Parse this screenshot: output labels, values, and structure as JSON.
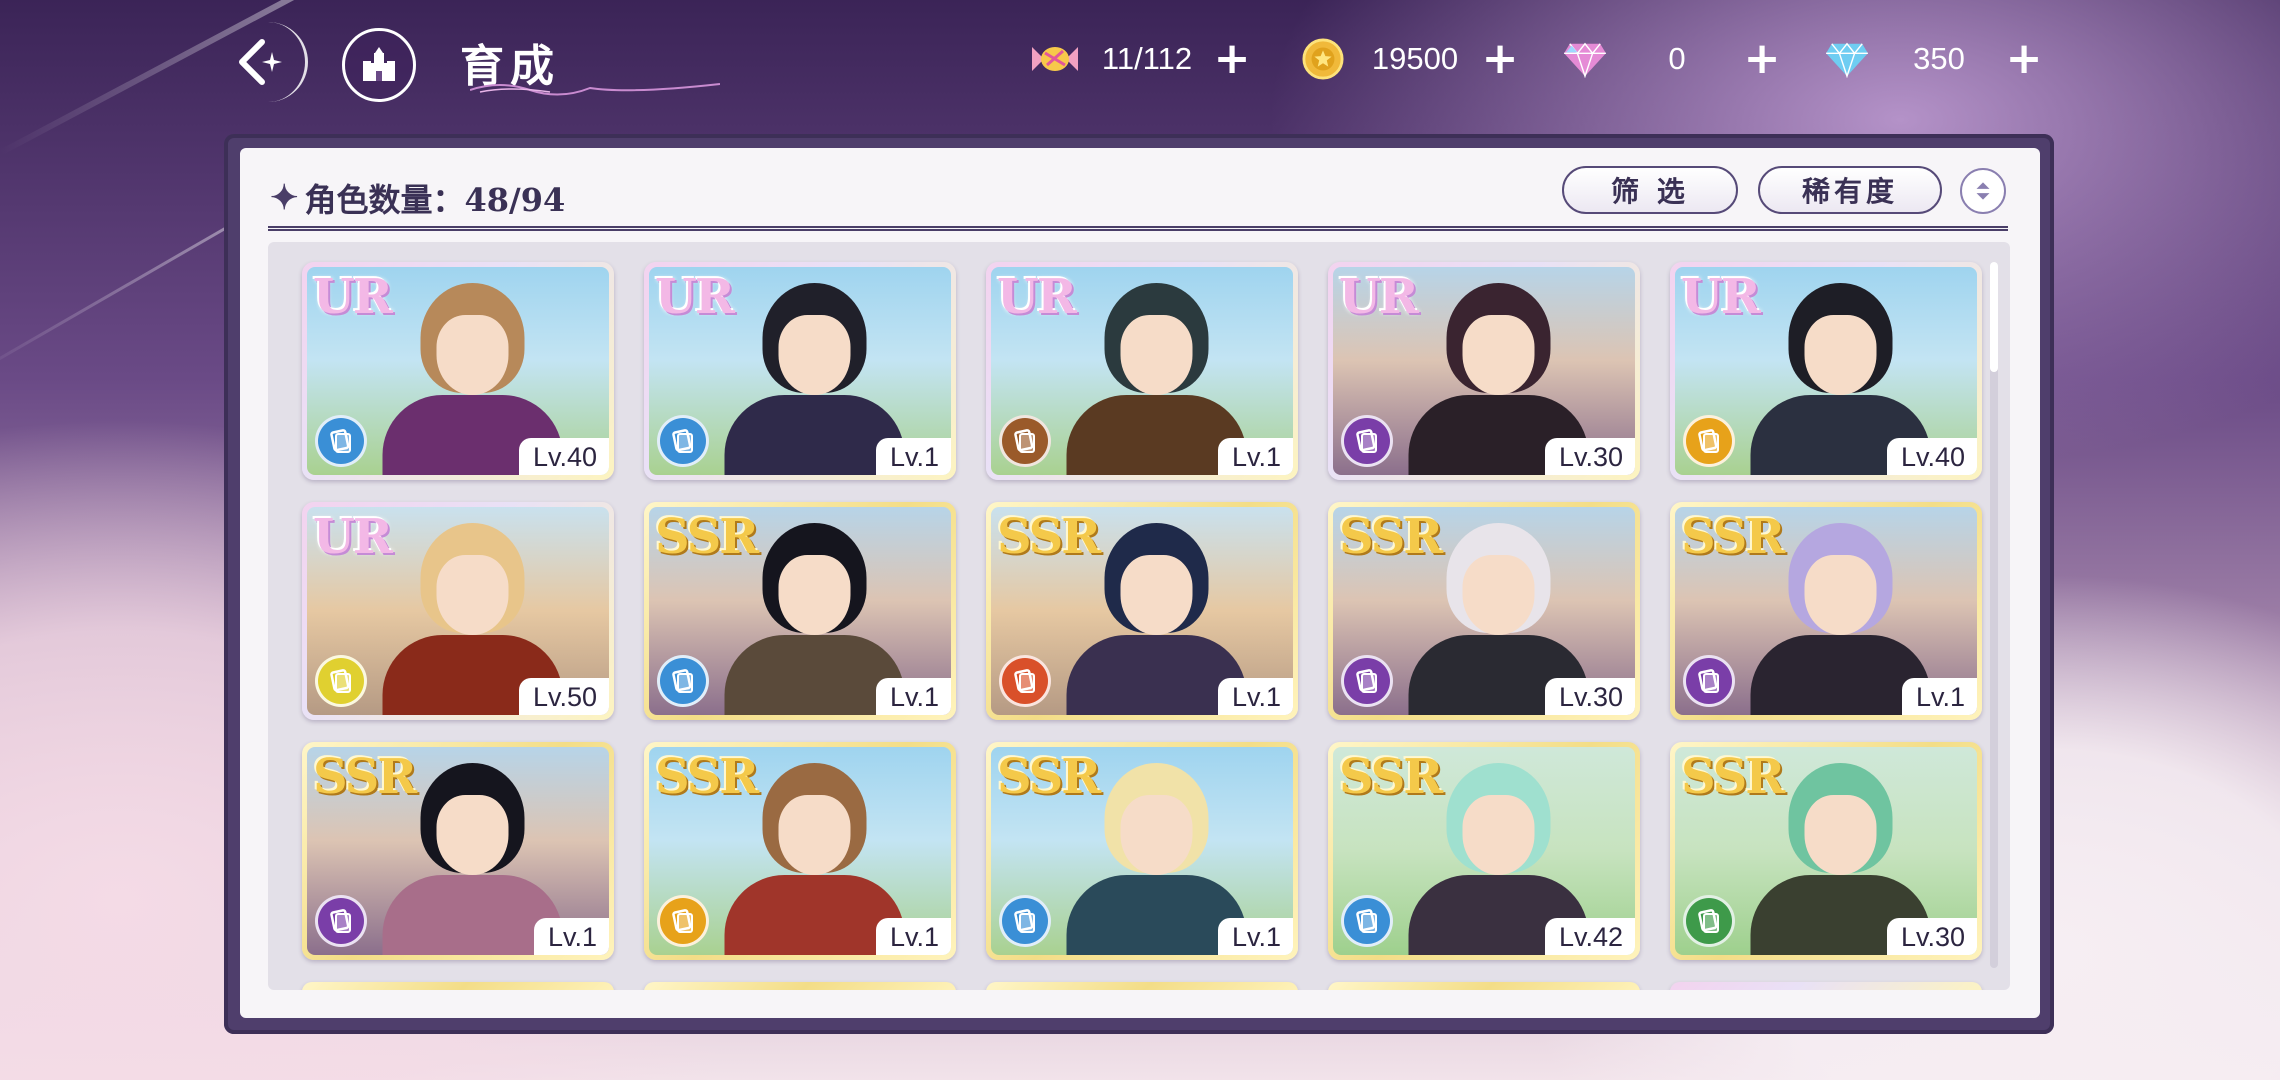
{
  "header": {
    "title": "育成",
    "resources": [
      {
        "name": "candy",
        "value": "11/112"
      },
      {
        "name": "gold-coin",
        "value": "19500"
      },
      {
        "name": "pink-gem",
        "value": "0"
      },
      {
        "name": "blue-gem",
        "value": "350"
      }
    ]
  },
  "panel": {
    "count_label": "角色数量：48/94",
    "filter_label": "筛 选",
    "sort_label": "稀有度"
  },
  "cards": [
    {
      "rarity": "UR",
      "level": "Lv.40",
      "type_color": "#3a8fd6",
      "hair": "#b7895a",
      "body": "#6b2f6e",
      "bg": "sky"
    },
    {
      "rarity": "UR",
      "level": "Lv.1",
      "type_color": "#3a8fd6",
      "hair": "#20202a",
      "body": "#2f2a4a",
      "bg": "sky"
    },
    {
      "rarity": "UR",
      "level": "Lv.1",
      "type_color": "#9a5a2a",
      "hair": "#2b3a3e",
      "body": "#5a3a22",
      "bg": "sky"
    },
    {
      "rarity": "UR",
      "level": "Lv.30",
      "type_color": "#7a3ea8",
      "hair": "#3a2430",
      "body": "#2a2028",
      "bg": "city"
    },
    {
      "rarity": "UR",
      "level": "Lv.40",
      "type_color": "#e7a21a",
      "hair": "#1e1e26",
      "body": "#2b3040",
      "bg": "sky"
    },
    {
      "rarity": "UR",
      "level": "Lv.50",
      "type_color": "#e0d030",
      "hair": "#e8c58a",
      "body": "#8a2a1a",
      "bg": "warm"
    },
    {
      "rarity": "SSR",
      "level": "Lv.1",
      "type_color": "#3a8fd6",
      "hair": "#15151e",
      "body": "#5a4a3a",
      "bg": "city"
    },
    {
      "rarity": "SSR",
      "level": "Lv.1",
      "type_color": "#d9502a",
      "hair": "#1f2a4a",
      "body": "#3a3050",
      "bg": "warm"
    },
    {
      "rarity": "SSR",
      "level": "Lv.30",
      "type_color": "#7a3ea8",
      "hair": "#e8e4ea",
      "body": "#2a2a32",
      "bg": "city"
    },
    {
      "rarity": "SSR",
      "level": "Lv.1",
      "type_color": "#7a3ea8",
      "hair": "#b5a7e0",
      "body": "#2a2430",
      "bg": "city"
    },
    {
      "rarity": "SSR",
      "level": "Lv.1",
      "type_color": "#7a3ea8",
      "hair": "#15151e",
      "body": "#a86e8a",
      "bg": "city"
    },
    {
      "rarity": "SSR",
      "level": "Lv.1",
      "type_color": "#e7a21a",
      "hair": "#9a6a42",
      "body": "#a0352a",
      "bg": "sky"
    },
    {
      "rarity": "SSR",
      "level": "Lv.1",
      "type_color": "#3a8fd6",
      "hair": "#f1e2a8",
      "body": "#2a4a5a",
      "bg": "sky"
    },
    {
      "rarity": "SSR",
      "level": "Lv.42",
      "type_color": "#3a8fd6",
      "hair": "#9fe0cf",
      "body": "#3a3040",
      "bg": "forest"
    },
    {
      "rarity": "SSR",
      "level": "Lv.30",
      "type_color": "#3e9a4a",
      "hair": "#6fc4a0",
      "body": "#3a4030",
      "bg": "forest"
    }
  ]
}
